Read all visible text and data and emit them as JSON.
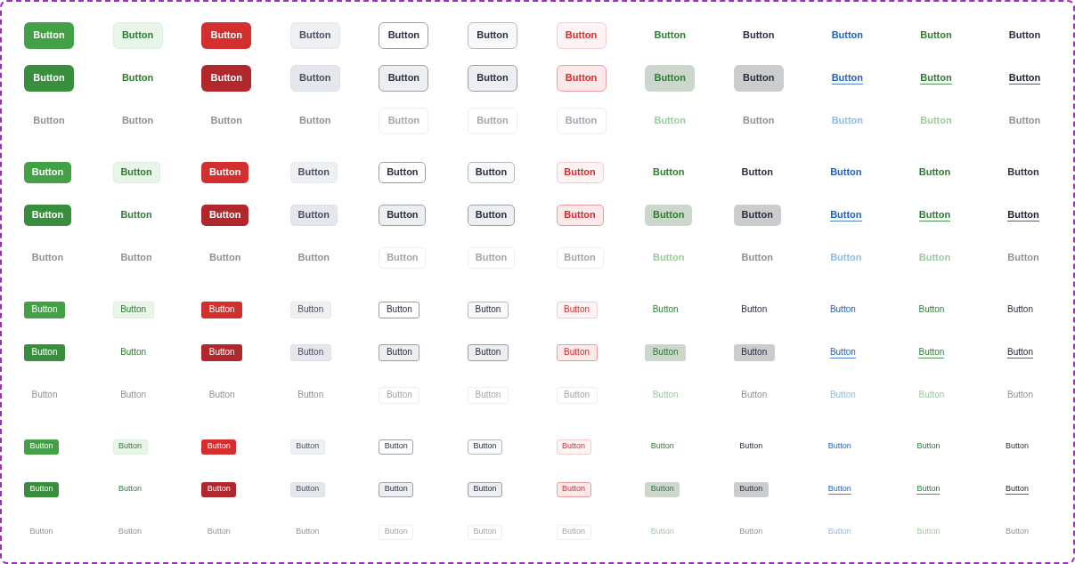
{
  "sizes": [
    {
      "kind": "large",
      "rows": [
        {
          "kind": "default",
          "buttons": [
            {
              "kind": "primary",
              "label": "Button"
            },
            {
              "kind": "secondary",
              "label": "Button"
            },
            {
              "kind": "danger",
              "label": "Button"
            },
            {
              "kind": "neutral",
              "label": "Button"
            },
            {
              "kind": "outline",
              "label": "Button"
            },
            {
              "kind": "muted",
              "label": "Button"
            },
            {
              "kind": "soft",
              "label": "Button"
            },
            {
              "kind": "ghost",
              "label": "Button"
            },
            {
              "kind": "plain",
              "label": "Button"
            },
            {
              "kind": "link",
              "label": "Button"
            },
            {
              "kind": "greenlink",
              "label": "Button"
            },
            {
              "kind": "darklink",
              "label": "Button"
            }
          ]
        },
        {
          "kind": "pressed",
          "buttons": [
            {
              "kind": "primary",
              "label": "Button"
            },
            {
              "kind": "secondary",
              "label": "Button"
            },
            {
              "kind": "danger",
              "label": "Button"
            },
            {
              "kind": "neutral",
              "label": "Button"
            },
            {
              "kind": "outline",
              "label": "Button"
            },
            {
              "kind": "muted",
              "label": "Button"
            },
            {
              "kind": "soft",
              "label": "Button"
            },
            {
              "kind": "ghost",
              "label": "Button"
            },
            {
              "kind": "plain",
              "label": "Button"
            },
            {
              "kind": "link",
              "label": "Button"
            },
            {
              "kind": "greenlink",
              "label": "Button"
            },
            {
              "kind": "darklink",
              "label": "Button"
            }
          ]
        },
        {
          "kind": "disabled",
          "buttons": [
            {
              "kind": "primary",
              "label": "Button"
            },
            {
              "kind": "secondary",
              "label": "Button"
            },
            {
              "kind": "danger",
              "label": "Button"
            },
            {
              "kind": "neutral",
              "label": "Button"
            },
            {
              "kind": "outline",
              "label": "Button"
            },
            {
              "kind": "muted",
              "label": "Button"
            },
            {
              "kind": "soft",
              "label": "Button"
            },
            {
              "kind": "ghost",
              "label": "Button"
            },
            {
              "kind": "plain",
              "label": "Button"
            },
            {
              "kind": "link",
              "label": "Button"
            },
            {
              "kind": "greenlink",
              "label": "Button"
            },
            {
              "kind": "darklink",
              "label": "Button"
            }
          ]
        }
      ]
    },
    {
      "kind": "medium",
      "rows": [
        {
          "kind": "default",
          "buttons": [
            {
              "kind": "primary",
              "label": "Button"
            },
            {
              "kind": "secondary",
              "label": "Button"
            },
            {
              "kind": "danger",
              "label": "Button"
            },
            {
              "kind": "neutral",
              "label": "Button"
            },
            {
              "kind": "outline",
              "label": "Button"
            },
            {
              "kind": "muted",
              "label": "Button"
            },
            {
              "kind": "soft",
              "label": "Button"
            },
            {
              "kind": "ghost",
              "label": "Button"
            },
            {
              "kind": "plain",
              "label": "Button"
            },
            {
              "kind": "link",
              "label": "Button"
            },
            {
              "kind": "greenlink",
              "label": "Button"
            },
            {
              "kind": "darklink",
              "label": "Button"
            }
          ]
        },
        {
          "kind": "pressed",
          "buttons": [
            {
              "kind": "primary",
              "label": "Button"
            },
            {
              "kind": "secondary",
              "label": "Button"
            },
            {
              "kind": "danger",
              "label": "Button"
            },
            {
              "kind": "neutral",
              "label": "Button"
            },
            {
              "kind": "outline",
              "label": "Button"
            },
            {
              "kind": "muted",
              "label": "Button"
            },
            {
              "kind": "soft",
              "label": "Button"
            },
            {
              "kind": "ghost",
              "label": "Button"
            },
            {
              "kind": "plain",
              "label": "Button"
            },
            {
              "kind": "link",
              "label": "Button"
            },
            {
              "kind": "greenlink",
              "label": "Button"
            },
            {
              "kind": "darklink",
              "label": "Button"
            }
          ]
        },
        {
          "kind": "disabled",
          "buttons": [
            {
              "kind": "primary",
              "label": "Button"
            },
            {
              "kind": "secondary",
              "label": "Button"
            },
            {
              "kind": "danger",
              "label": "Button"
            },
            {
              "kind": "neutral",
              "label": "Button"
            },
            {
              "kind": "outline",
              "label": "Button"
            },
            {
              "kind": "muted",
              "label": "Button"
            },
            {
              "kind": "soft",
              "label": "Button"
            },
            {
              "kind": "ghost",
              "label": "Button"
            },
            {
              "kind": "plain",
              "label": "Button"
            },
            {
              "kind": "link",
              "label": "Button"
            },
            {
              "kind": "greenlink",
              "label": "Button"
            },
            {
              "kind": "darklink",
              "label": "Button"
            }
          ]
        }
      ]
    },
    {
      "kind": "small",
      "rows": [
        {
          "kind": "default",
          "buttons": [
            {
              "kind": "primary",
              "label": "Button"
            },
            {
              "kind": "secondary",
              "label": "Button"
            },
            {
              "kind": "danger",
              "label": "Button"
            },
            {
              "kind": "neutral",
              "label": "Button"
            },
            {
              "kind": "outline",
              "label": "Button"
            },
            {
              "kind": "muted",
              "label": "Button"
            },
            {
              "kind": "soft",
              "label": "Button"
            },
            {
              "kind": "ghost",
              "label": "Button"
            },
            {
              "kind": "plain",
              "label": "Button"
            },
            {
              "kind": "link",
              "label": "Button"
            },
            {
              "kind": "greenlink",
              "label": "Button"
            },
            {
              "kind": "darklink",
              "label": "Button"
            }
          ]
        },
        {
          "kind": "pressed",
          "buttons": [
            {
              "kind": "primary",
              "label": "Button"
            },
            {
              "kind": "secondary",
              "label": "Button"
            },
            {
              "kind": "danger",
              "label": "Button"
            },
            {
              "kind": "neutral",
              "label": "Button"
            },
            {
              "kind": "outline",
              "label": "Button"
            },
            {
              "kind": "muted",
              "label": "Button"
            },
            {
              "kind": "soft",
              "label": "Button"
            },
            {
              "kind": "ghost",
              "label": "Button"
            },
            {
              "kind": "plain",
              "label": "Button"
            },
            {
              "kind": "link",
              "label": "Button"
            },
            {
              "kind": "greenlink",
              "label": "Button"
            },
            {
              "kind": "darklink",
              "label": "Button"
            }
          ]
        },
        {
          "kind": "disabled",
          "buttons": [
            {
              "kind": "primary",
              "label": "Button"
            },
            {
              "kind": "secondary",
              "label": "Button"
            },
            {
              "kind": "danger",
              "label": "Button"
            },
            {
              "kind": "neutral",
              "label": "Button"
            },
            {
              "kind": "outline",
              "label": "Button"
            },
            {
              "kind": "muted",
              "label": "Button"
            },
            {
              "kind": "soft",
              "label": "Button"
            },
            {
              "kind": "ghost",
              "label": "Button"
            },
            {
              "kind": "plain",
              "label": "Button"
            },
            {
              "kind": "link",
              "label": "Button"
            },
            {
              "kind": "greenlink",
              "label": "Button"
            },
            {
              "kind": "darklink",
              "label": "Button"
            }
          ]
        }
      ]
    },
    {
      "kind": "tiny",
      "rows": [
        {
          "kind": "default",
          "buttons": [
            {
              "kind": "primary",
              "label": "Button"
            },
            {
              "kind": "secondary",
              "label": "Button"
            },
            {
              "kind": "danger",
              "label": "Button"
            },
            {
              "kind": "neutral",
              "label": "Button"
            },
            {
              "kind": "outline",
              "label": "Button"
            },
            {
              "kind": "muted",
              "label": "Button"
            },
            {
              "kind": "soft",
              "label": "Button"
            },
            {
              "kind": "ghost",
              "label": "Button"
            },
            {
              "kind": "plain",
              "label": "Button"
            },
            {
              "kind": "link",
              "label": "Button"
            },
            {
              "kind": "greenlink",
              "label": "Button"
            },
            {
              "kind": "darklink",
              "label": "Button"
            }
          ]
        },
        {
          "kind": "pressed",
          "buttons": [
            {
              "kind": "primary",
              "label": "Button"
            },
            {
              "kind": "secondary",
              "label": "Button"
            },
            {
              "kind": "danger",
              "label": "Button"
            },
            {
              "kind": "neutral",
              "label": "Button"
            },
            {
              "kind": "outline",
              "label": "Button"
            },
            {
              "kind": "muted",
              "label": "Button"
            },
            {
              "kind": "soft",
              "label": "Button"
            },
            {
              "kind": "ghost",
              "label": "Button"
            },
            {
              "kind": "plain",
              "label": "Button"
            },
            {
              "kind": "link",
              "label": "Button"
            },
            {
              "kind": "greenlink",
              "label": "Button"
            },
            {
              "kind": "darklink",
              "label": "Button"
            }
          ]
        },
        {
          "kind": "disabled",
          "buttons": [
            {
              "kind": "primary",
              "label": "Button"
            },
            {
              "kind": "secondary",
              "label": "Button"
            },
            {
              "kind": "danger",
              "label": "Button"
            },
            {
              "kind": "neutral",
              "label": "Button"
            },
            {
              "kind": "outline",
              "label": "Button"
            },
            {
              "kind": "muted",
              "label": "Button"
            },
            {
              "kind": "soft",
              "label": "Button"
            },
            {
              "kind": "ghost",
              "label": "Button"
            },
            {
              "kind": "plain",
              "label": "Button"
            },
            {
              "kind": "link",
              "label": "Button"
            },
            {
              "kind": "greenlink",
              "label": "Button"
            },
            {
              "kind": "darklink",
              "label": "Button"
            }
          ]
        }
      ]
    }
  ]
}
